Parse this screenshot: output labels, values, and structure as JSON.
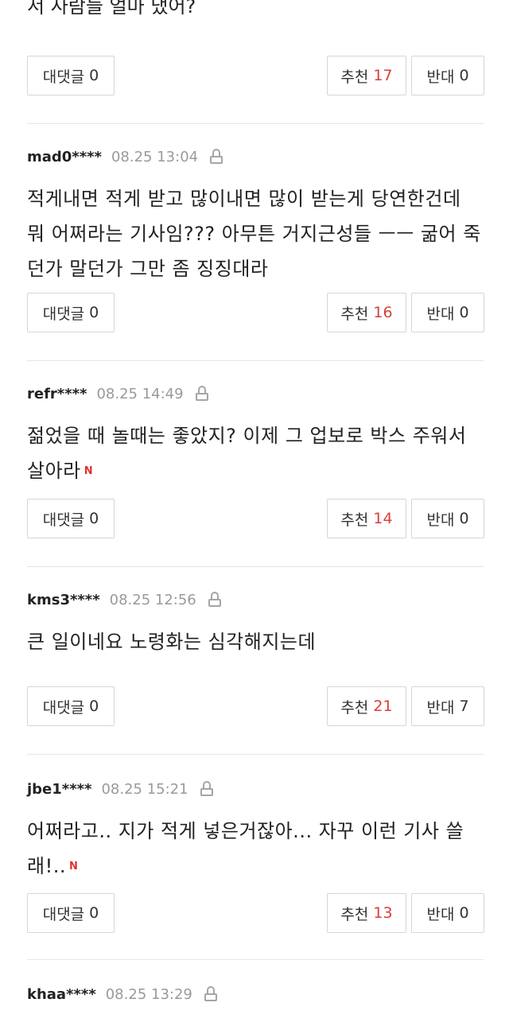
{
  "top": {
    "text": "서 사람들 얼마 냈어?",
    "reply_label": "대댓글",
    "reply_count": "0",
    "up_label": "추천",
    "up_count": "17",
    "down_label": "반대",
    "down_count": "0"
  },
  "comments": [
    {
      "user": "mad0****",
      "date": "08.25 13:04",
      "text": "적게내면 적게 받고 많이내면 많이 받는게 당연한건데 뭐 어쩌라는 기사임??? 아무튼 거지근성들 ㅡㅡ 굶어 죽던가 말던가 그만 좀 징징대라",
      "new_badge": "",
      "reply_label": "대댓글",
      "reply_count": "0",
      "up_label": "추천",
      "up_count": "16",
      "down_label": "반대",
      "down_count": "0"
    },
    {
      "user": "refr****",
      "date": "08.25 14:49",
      "text": "젊었을 때 놀때는 좋았지? 이제 그 업보로 박스 주워서 살아라",
      "new_badge": "N",
      "reply_label": "대댓글",
      "reply_count": "0",
      "up_label": "추천",
      "up_count": "14",
      "down_label": "반대",
      "down_count": "0"
    },
    {
      "user": "kms3****",
      "date": "08.25 12:56",
      "text": "큰 일이네요 노령화는 심각해지는데",
      "new_badge": "",
      "reply_label": "대댓글",
      "reply_count": "0",
      "up_label": "추천",
      "up_count": "21",
      "down_label": "반대",
      "down_count": "7"
    },
    {
      "user": "jbe1****",
      "date": "08.25 15:21",
      "text": "어쩌라고.. 지가 적게 넣은거잖아... 자꾸 이런 기사 쓸래!..",
      "new_badge": "N",
      "reply_label": "대댓글",
      "reply_count": "0",
      "up_label": "추천",
      "up_count": "13",
      "down_label": "반대",
      "down_count": "0"
    },
    {
      "user": "khaa****",
      "date": "08.25 13:29"
    }
  ],
  "icons": {
    "lock": "lock-icon",
    "new": "new-badge"
  },
  "colors": {
    "accent_red": "#d7403a",
    "meta_gray": "#9a9a9a",
    "border": "#d6d6d6"
  }
}
